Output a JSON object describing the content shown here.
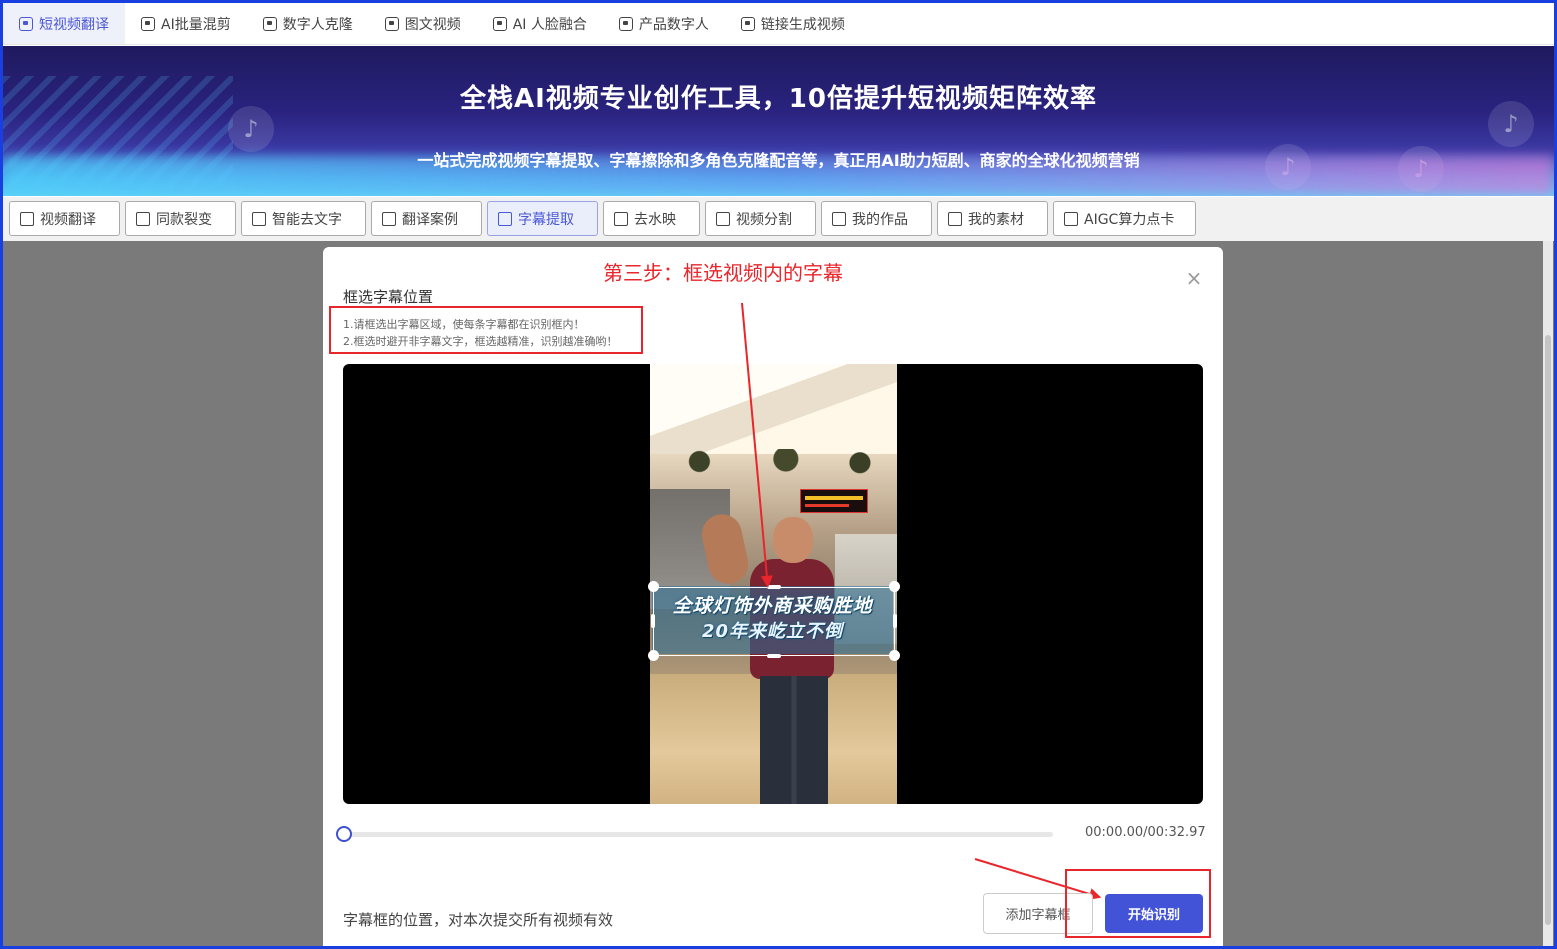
{
  "top_nav": [
    {
      "label": "短视频翻译",
      "icon": "video-translate-icon",
      "active": true
    },
    {
      "label": "AI批量混剪",
      "icon": "batch-edit-icon",
      "active": false
    },
    {
      "label": "数字人克隆",
      "icon": "digital-human-icon",
      "active": false
    },
    {
      "label": "图文视频",
      "icon": "image-video-icon",
      "active": false
    },
    {
      "label": "AI 人脸融合",
      "icon": "face-fusion-icon",
      "active": false
    },
    {
      "label": "产品数字人",
      "icon": "product-human-icon",
      "active": false
    },
    {
      "label": "链接生成视频",
      "icon": "link-video-icon",
      "active": false
    }
  ],
  "banner": {
    "title": "全栈AI视频专业创作工具，10倍提升短视频矩阵效率",
    "subtitle": "一站式完成视频字幕提取、字幕擦除和多角色克隆配音等，真正用AI助力短剧、商家的全球化视频营销"
  },
  "tool_tabs": [
    {
      "label": "视频翻译",
      "active": false
    },
    {
      "label": "同款裂变",
      "active": false
    },
    {
      "label": "智能去文字",
      "active": false
    },
    {
      "label": "翻译案例",
      "active": false
    },
    {
      "label": "字幕提取",
      "active": true
    },
    {
      "label": "去水映",
      "active": false
    },
    {
      "label": "视频分割",
      "active": false
    },
    {
      "label": "我的作品",
      "active": false
    },
    {
      "label": "我的素材",
      "active": false
    },
    {
      "label": "AIGC算力点卡",
      "active": false
    }
  ],
  "dialog": {
    "step_title": "第三步：框选视频内的字幕",
    "section_title": "框选字幕位置",
    "hints": [
      "1.请框选出字幕区域，使每条字幕都在识别框内！",
      "2.框选时避开非字幕文字，框选越精准，识别越准确哟！"
    ],
    "close_label": "×",
    "video_caption": [
      "全球灯饰外商采购胜地",
      "20年来屹立不倒"
    ],
    "time": "00:00.00/00:32.97",
    "progress": 0,
    "footer_note": "字幕框的位置，对本次提交所有视频有效",
    "add_button": "添加字幕框",
    "start_button": "开始识别"
  },
  "colors": {
    "accent": "#4353d8",
    "annotation_red": "#e8262b",
    "frame_blue": "#1a3fe0"
  }
}
